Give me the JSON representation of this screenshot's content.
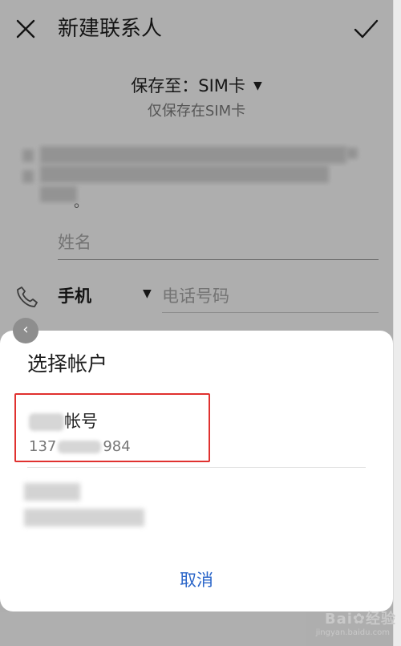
{
  "header": {
    "title": "新建联系人",
    "close_icon": "close-icon",
    "confirm_icon": "check-icon"
  },
  "save_location": {
    "label": "保存至：SIM卡",
    "caret": "▼",
    "subtitle": "仅保存在SIM卡"
  },
  "notice": {
    "suffix": "。"
  },
  "form": {
    "name_placeholder": "姓名",
    "phone_type": "手机",
    "phone_type_caret": "▼",
    "phone_placeholder": "电话号码"
  },
  "dialog": {
    "back_icon": "‹",
    "title": "选择帐户",
    "accounts": [
      {
        "name_visible": "帐号",
        "number_prefix": "137",
        "number_suffix": "984"
      }
    ],
    "cancel_label": "取消"
  },
  "colors": {
    "highlight_border": "#e0312f",
    "accent": "#2b66c9"
  }
}
